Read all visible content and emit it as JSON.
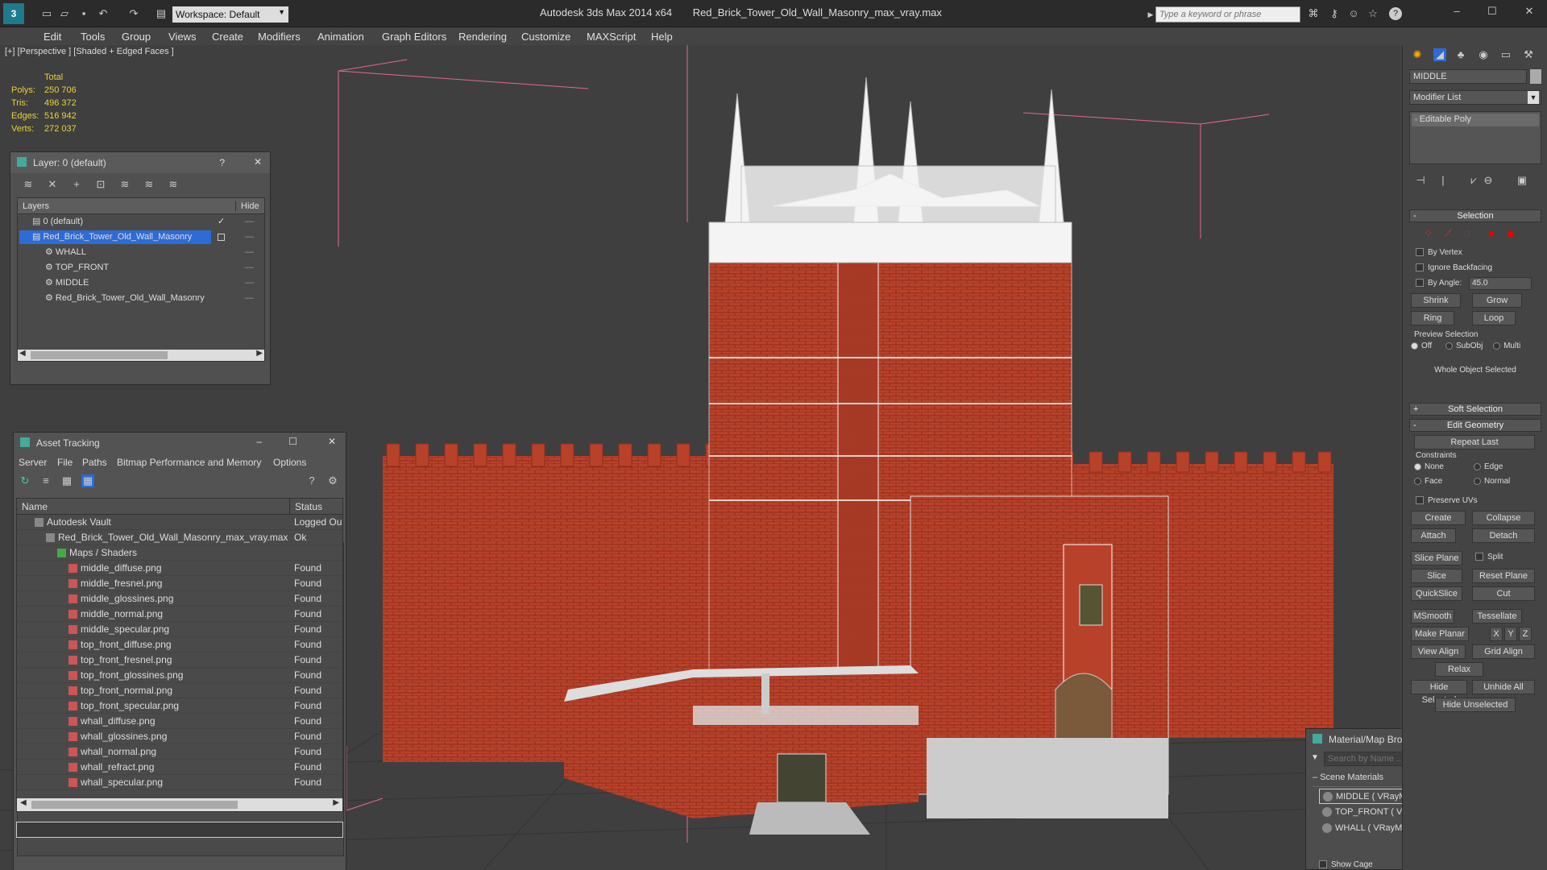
{
  "app": {
    "window_title": "Autodesk 3ds Max  2014 x64",
    "file_name": "Red_Brick_Tower_Old_Wall_Masonry_max_vray.max",
    "workspace_label": "Workspace: Default",
    "search_placeholder": "Type a keyword or phrase"
  },
  "menu": [
    "Edit",
    "Tools",
    "Group",
    "Views",
    "Create",
    "Modifiers",
    "Animation",
    "Graph Editors",
    "Rendering",
    "Customize",
    "MAXScript",
    "Help"
  ],
  "viewport": {
    "label": "[+] [Perspective ] [Shaded + Edged Faces ]",
    "stats": {
      "header": "Total",
      "rows": [
        {
          "label": "Polys:",
          "value": "250 706"
        },
        {
          "label": "Tris:",
          "value": "496 372"
        },
        {
          "label": "Edges:",
          "value": "516 942"
        },
        {
          "label": "Verts:",
          "value": "272 037"
        }
      ]
    }
  },
  "layer_panel": {
    "title": "Layer: 0 (default)",
    "help": "?",
    "columns": {
      "layers": "Layers",
      "hide": "Hide"
    },
    "rows": [
      {
        "name": "0 (default)",
        "indent": 0
      },
      {
        "name": "Red_Brick_Tower_Old_Wall_Masonry",
        "indent": 0,
        "selected": true
      },
      {
        "name": "WHALL",
        "indent": 1
      },
      {
        "name": "TOP_FRONT",
        "indent": 1
      },
      {
        "name": "MIDDLE",
        "indent": 1
      },
      {
        "name": "Red_Brick_Tower_Old_Wall_Masonry",
        "indent": 1
      }
    ]
  },
  "asset_panel": {
    "title": "Asset Tracking",
    "menu": [
      "Server",
      "File",
      "Paths",
      "Bitmap Performance and Memory",
      "Options"
    ],
    "columns": {
      "name": "Name",
      "status": "Status"
    },
    "rows": [
      {
        "name": "Autodesk Vault",
        "status": "Logged Ou",
        "indent": 1
      },
      {
        "name": "Red_Brick_Tower_Old_Wall_Masonry_max_vray.max",
        "status": "Ok",
        "indent": 2
      },
      {
        "name": "Maps / Shaders",
        "status": "",
        "indent": 3
      },
      {
        "name": "middle_diffuse.png",
        "status": "Found",
        "indent": 4
      },
      {
        "name": "middle_fresnel.png",
        "status": "Found",
        "indent": 4
      },
      {
        "name": "middle_glossines.png",
        "status": "Found",
        "indent": 4
      },
      {
        "name": "middle_normal.png",
        "status": "Found",
        "indent": 4
      },
      {
        "name": "middle_specular.png",
        "status": "Found",
        "indent": 4
      },
      {
        "name": "top_front_diffuse.png",
        "status": "Found",
        "indent": 4
      },
      {
        "name": "top_front_fresnel.png",
        "status": "Found",
        "indent": 4
      },
      {
        "name": "top_front_glossines.png",
        "status": "Found",
        "indent": 4
      },
      {
        "name": "top_front_normal.png",
        "status": "Found",
        "indent": 4
      },
      {
        "name": "top_front_specular.png",
        "status": "Found",
        "indent": 4
      },
      {
        "name": "whall_diffuse.png",
        "status": "Found",
        "indent": 4
      },
      {
        "name": "whall_glossines.png",
        "status": "Found",
        "indent": 4
      },
      {
        "name": "whall_normal.png",
        "status": "Found",
        "indent": 4
      },
      {
        "name": "whall_refract.png",
        "status": "Found",
        "indent": 4
      },
      {
        "name": "whall_specular.png",
        "status": "Found",
        "indent": 4
      }
    ]
  },
  "material_browser": {
    "title": "Material/Map Browser",
    "search_placeholder": "Search by Name ...",
    "group": "Scene Materials",
    "items": [
      "MIDDLE  ( VRayMtl ) [MIDDLE]",
      "TOP_FRONT  ( VRayMtl ) [TOP_FRONT]",
      "WHALL  ( VRayMtl ) [WHALL]"
    ],
    "show_cage": "Show Cage"
  },
  "command_panel": {
    "object_name": "MIDDLE",
    "modifier_list": "Modifier List",
    "stack_item": "Editable Poly",
    "selection": {
      "title": "Selection",
      "by_vertex": "By Vertex",
      "ignore_backfacing": "Ignore Backfacing",
      "by_angle": "By Angle:",
      "angle_value": "45.0",
      "shrink": "Shrink",
      "grow": "Grow",
      "ring": "Ring",
      "loop": "Loop",
      "preview_label": "Preview Selection",
      "preview_options": [
        "Off",
        "SubObj",
        "Multi"
      ],
      "status": "Whole Object Selected"
    },
    "soft_selection": "Soft Selection",
    "edit_geometry": {
      "title": "Edit Geometry",
      "repeat_last": "Repeat Last",
      "constraints": "Constraints",
      "constraint_options": [
        "None",
        "Edge",
        "Face",
        "Normal"
      ],
      "preserve_uvs": "Preserve UVs",
      "create": "Create",
      "collapse": "Collapse",
      "attach": "Attach",
      "detach": "Detach",
      "slice_plane": "Slice Plane",
      "split": "Split",
      "slice": "Slice",
      "reset_plane": "Reset Plane",
      "quickslice": "QuickSlice",
      "cut": "Cut",
      "msmooth": "MSmooth",
      "tessellate": "Tessellate",
      "make_planar": "Make Planar",
      "x": "X",
      "y": "Y",
      "z": "Z",
      "view_align": "View Align",
      "grid_align": "Grid Align",
      "relax": "Relax",
      "hide_selected": "Hide Selected",
      "unhide_all": "Unhide All",
      "hide_unselected": "Hide Unselected"
    }
  },
  "colors": {
    "brick": "#b8412a",
    "selection_blue": "#2d6bd6",
    "stat_yellow": "#e8d23a"
  }
}
